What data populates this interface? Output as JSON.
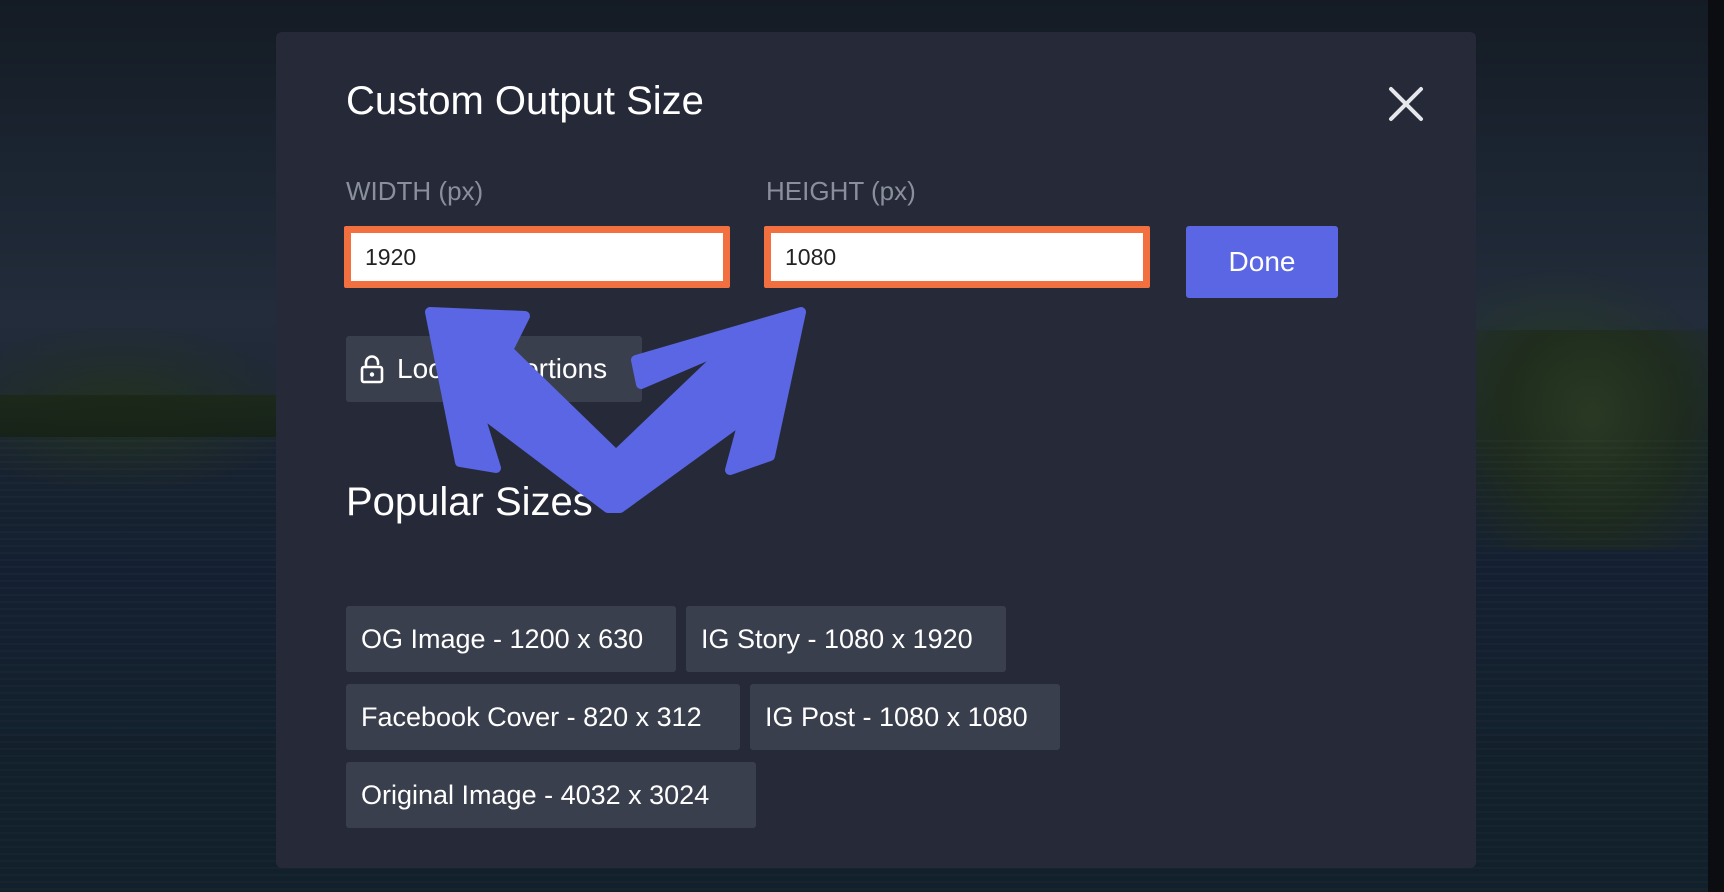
{
  "dialog": {
    "title": "Custom Output Size",
    "close_icon": "close-icon"
  },
  "fields": {
    "width": {
      "label": "WIDTH (px)",
      "value": "1920"
    },
    "height": {
      "label": "HEIGHT (px)",
      "value": "1080"
    }
  },
  "done_label": "Done",
  "lock": {
    "label": "Lock Proportions",
    "icon": "lock-icon"
  },
  "popular": {
    "title": "Popular Sizes",
    "items": [
      {
        "label": "OG Image - 1200 x 630"
      },
      {
        "label": "IG Story - 1080 x 1920"
      },
      {
        "label": "Facebook Cover - 820 x 312"
      },
      {
        "label": "IG Post - 1080 x 1080"
      },
      {
        "label": "Original Image - 4032 x 3024"
      }
    ]
  },
  "colors": {
    "modal_bg": "#262a38",
    "button_bg": "#3a3f4d",
    "accent": "#5a66e3",
    "highlight": "#f2703f",
    "annotation": "#5a66e3"
  }
}
